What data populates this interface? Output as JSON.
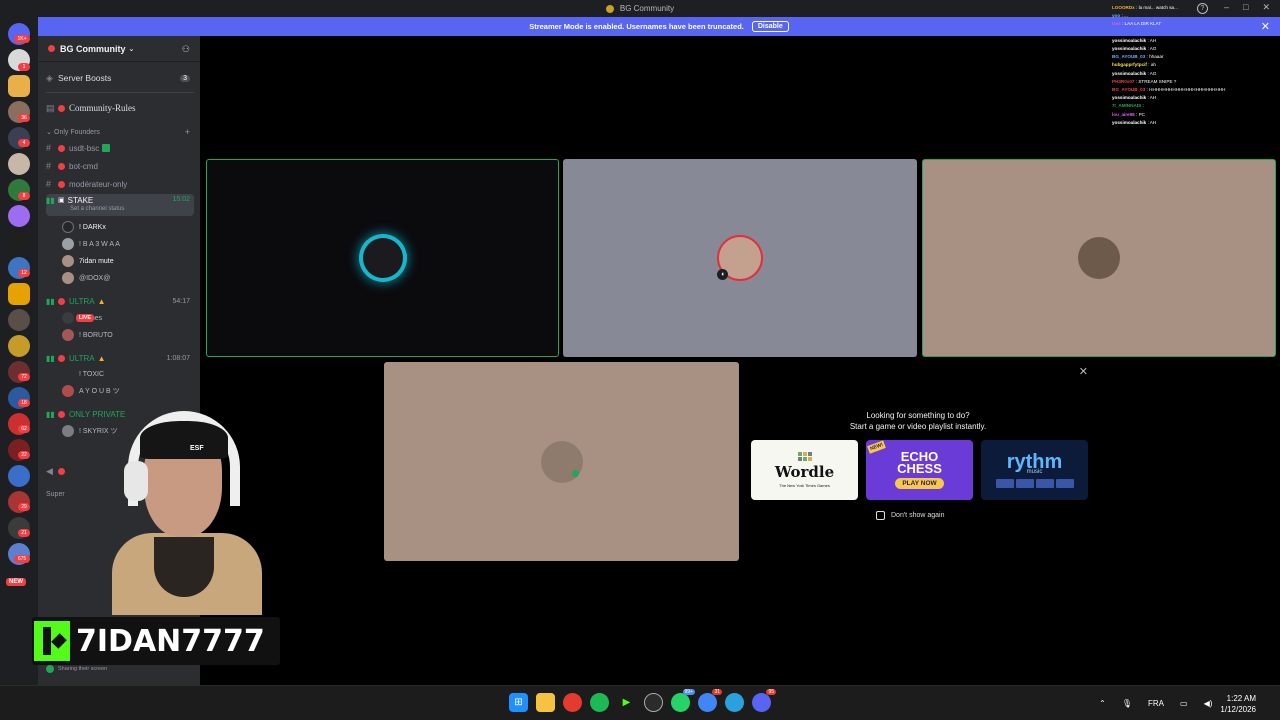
{
  "window": {
    "title": "BG Community"
  },
  "banner": {
    "text": "Streamer Mode is enabled. Usernames have been truncated.",
    "disable_label": "Disable"
  },
  "rail": {
    "badges": [
      "1K+",
      "1",
      "36",
      "4",
      "8",
      "12",
      "72",
      "18",
      "62",
      "22",
      "29",
      "21",
      "675"
    ],
    "new_label": "NEW"
  },
  "server": {
    "name": "BG Community"
  },
  "sidebar": {
    "boosts": {
      "label": "Server Boosts",
      "count": "3"
    },
    "rules": "Community-Rules",
    "category": "Only Founders",
    "channels": [
      "usdt-bsc",
      "bot-cmd",
      "modérateur-only"
    ],
    "stake": {
      "name": "STAKE",
      "time": "15:02",
      "status": "Set a channel status"
    },
    "stake_users": [
      "! DARKx",
      "! B A 3 W A A",
      "7idan mute",
      "@IDOX@"
    ],
    "ultra1": {
      "name": "ULTRA",
      "time": "54:17",
      "users": [
        "Younes",
        "! BORUTO"
      ],
      "live": "LIVE"
    },
    "ultra2": {
      "name": "ULTRA",
      "time": "1:08:07",
      "users": [
        "! TOXIC",
        "A Y O U B ツ"
      ]
    },
    "private": {
      "name": "ONLY PRIVATE",
      "users": [
        "! SKYRIX ツ"
      ]
    },
    "footer_label": "Super",
    "sharing": "Sharing their screen"
  },
  "activity": {
    "title_line1": "Looking for something to do?",
    "title_line2": "Start a game or video playlist instantly.",
    "wordle": {
      "title": "Wordle",
      "subtitle": "The New York Times Games"
    },
    "echo": {
      "title_line1": "ECHO",
      "title_line2": "CHESS",
      "button": "PLAY NOW",
      "tag": "NEW!"
    },
    "rythm": {
      "title": "rythm",
      "subtitle": "music"
    },
    "dont_show": "Don't show again"
  },
  "chat": [
    {
      "n": "LOOORDx",
      "m": "la mal... watch sa..."
    },
    {
      "n": "yoo",
      "m": "..."
    },
    {
      "n": "Oss",
      "m": "LAA LA DIR KLAT"
    },
    {
      "n": "",
      "m": ""
    },
    {
      "n": "yossimoalachik",
      "m": "AH"
    },
    {
      "n": "yossimoalachik",
      "m": "AG"
    },
    {
      "n": "BG_AYOUB_03",
      "m": "hhaaar"
    },
    {
      "n": "hubgapprfytpcif",
      "m": "ah"
    },
    {
      "n": "yossimoalachik",
      "m": "AG"
    },
    {
      "n": "PH3R0x07",
      "m": "STREAM SNIPE ?"
    },
    {
      "n": "BG_AYOUB_03",
      "m": "HHHHHHHHHHHHHHHHHHHHHHH"
    },
    {
      "n": "yossimoalachik",
      "m": "AH"
    },
    {
      "n": "7I_AMINNADI",
      "m": ""
    },
    {
      "n": "lou_aire98",
      "m": "PC"
    },
    {
      "n": "yossimoalachik",
      "m": "AH"
    }
  ],
  "overlay": {
    "cam_text": "ESF",
    "name": "7IDAN7777"
  },
  "taskbar": {
    "badges": {
      "whatsapp": "99+",
      "chrome": "31",
      "discord": "95"
    },
    "lang": "FRA",
    "time": "1:22 AM",
    "date": "1/12/2026"
  },
  "colors": {
    "accent": "#5865f2",
    "speaking": "#23a55a",
    "kick": "#53fc18",
    "danger": "#f23f43"
  }
}
